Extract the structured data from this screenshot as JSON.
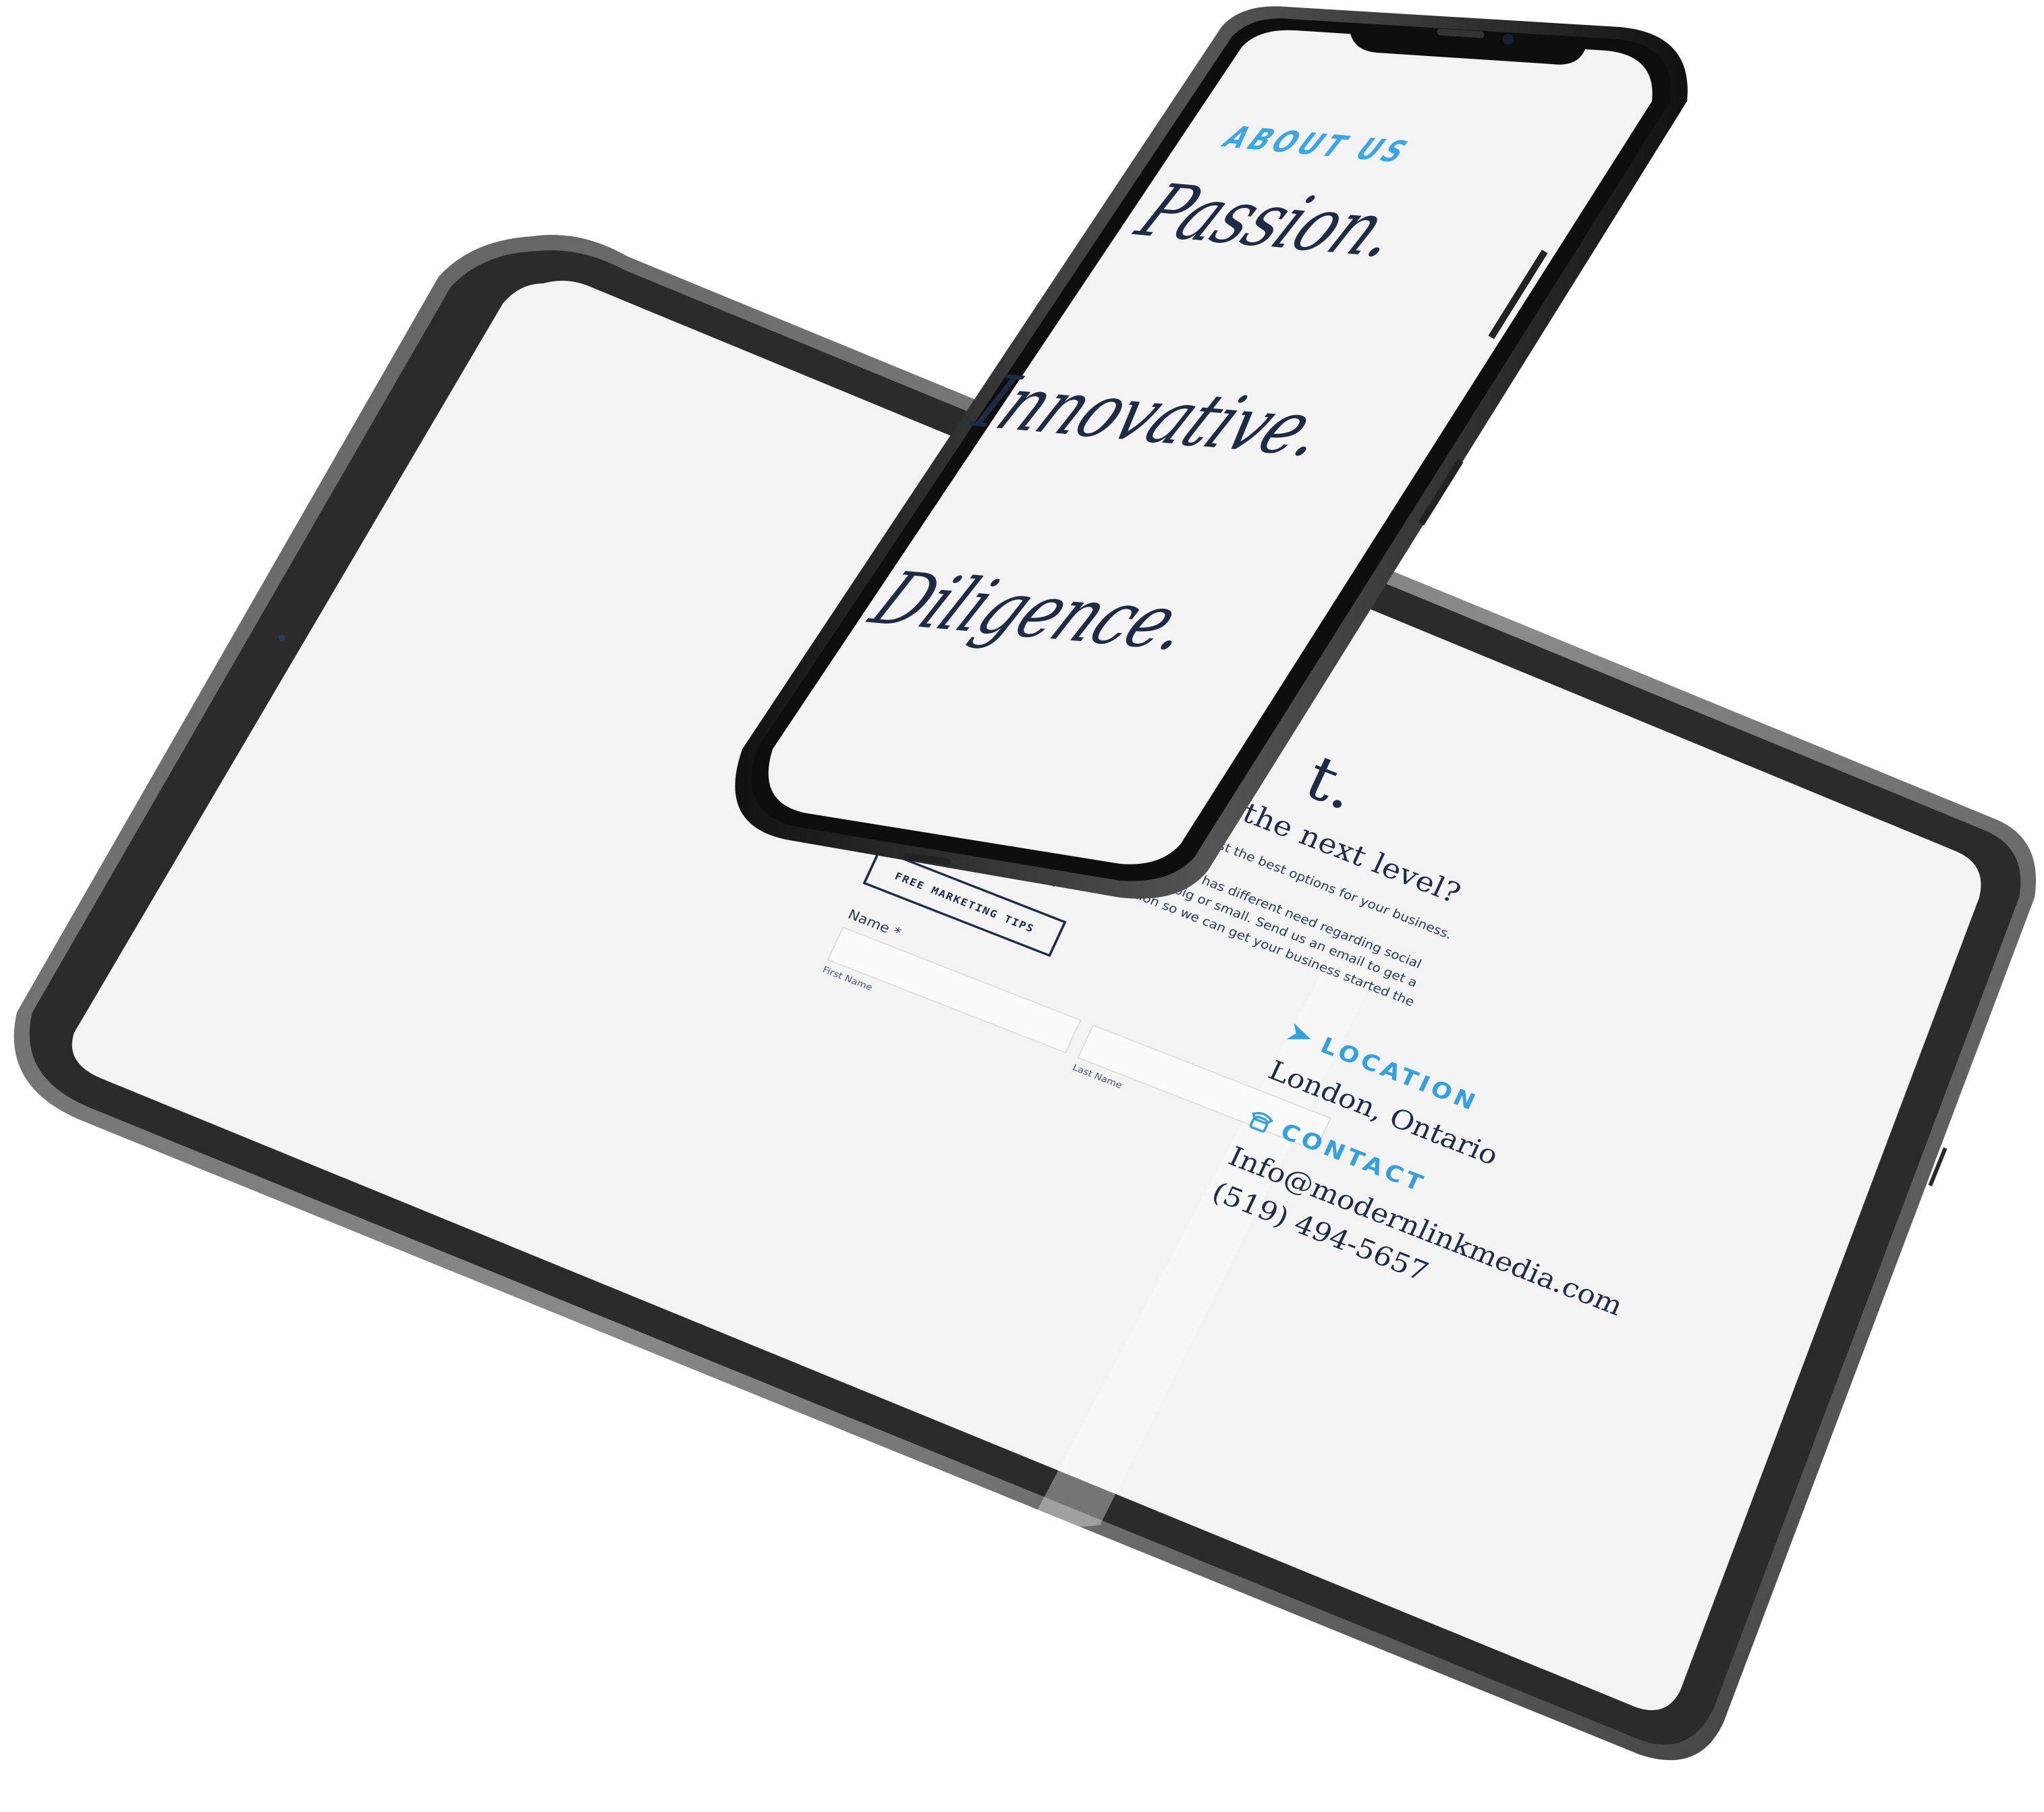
{
  "tablet": {
    "heading": "Ready to step up to the next level?",
    "subheading": "Let us know a bit about you, so we can suggest the best options for your business.",
    "body": "We know that every business is different and has different need regarding social media, so we are ready to tackle any task big or small. Send us an email to get a FREE social media audit and consultation so we can get your business started the right way on social media.",
    "cta_button": "FREE MARKETING TIPS",
    "name_label": "Name *",
    "first_name_label": "First Name",
    "last_name_label": "Last Name",
    "partial_heading_letter": "t.",
    "location_title": "LOCATION",
    "location_value": "London, Ontario",
    "contact_title": "CONTACT",
    "email": "Info@modernlinkmedia.com",
    "phone": "(519) 494-5657",
    "location_icon": "location-arrow-icon",
    "contact_icon": "phone-icon"
  },
  "phone": {
    "about_label": "ABOUT US",
    "words": [
      "Passion.",
      "Innovative.",
      "Diligence."
    ]
  },
  "colors": {
    "navy_text": "#1f2a44",
    "accent_blue": "#35a0e0",
    "screen_bg": "#f3f3f3",
    "bezel": "#2b2b2b",
    "frame": "#3a3a3a"
  }
}
